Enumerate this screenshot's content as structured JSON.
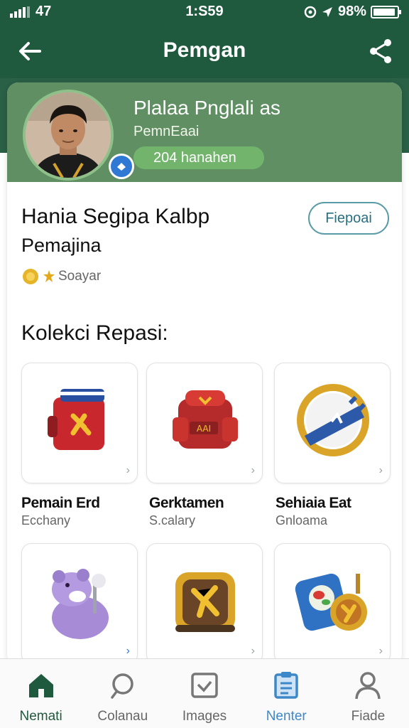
{
  "status_bar": {
    "signal_text": "47",
    "time": "1:S59",
    "battery": "98%"
  },
  "app_bar": {
    "title": "Pemgan"
  },
  "profile": {
    "name": "Plalaa Pnglali as",
    "role": "PemnEaai",
    "badge": "204 hanahen"
  },
  "club": {
    "name": "Hania Segipa Kalbp",
    "subtitle": "Pemajina",
    "follow_label": "Fiepoai",
    "rating_label": "Soayar"
  },
  "collection": {
    "title": "Kolekci Repasi:",
    "items": [
      {
        "name": "Pemain Erd",
        "category": "Ecchany",
        "icon": "backpack-icon"
      },
      {
        "name": "Gerktamen",
        "category": "S.calary",
        "icon": "bag-icon"
      },
      {
        "name": "Sehiaia Eat",
        "category": "Gnloama",
        "icon": "ring-icon"
      },
      {
        "name": "",
        "category": "",
        "icon": "bear-mascot-icon"
      },
      {
        "name": "",
        "category": "",
        "icon": "gold-crate-icon"
      },
      {
        "name": "",
        "category": "",
        "icon": "compass-icon"
      }
    ]
  },
  "bottom_nav": [
    {
      "label": "Nemati",
      "icon": "home-icon"
    },
    {
      "label": "Colanau",
      "icon": "search-icon"
    },
    {
      "label": "Images",
      "icon": "images-icon"
    },
    {
      "label": "Nenter",
      "icon": "clipboard-icon"
    },
    {
      "label": "Fiade",
      "icon": "profile-icon"
    }
  ],
  "colors": {
    "primary": "#1f5a3e",
    "header": "#5f8f62",
    "accent_blue": "#3d88c8"
  }
}
